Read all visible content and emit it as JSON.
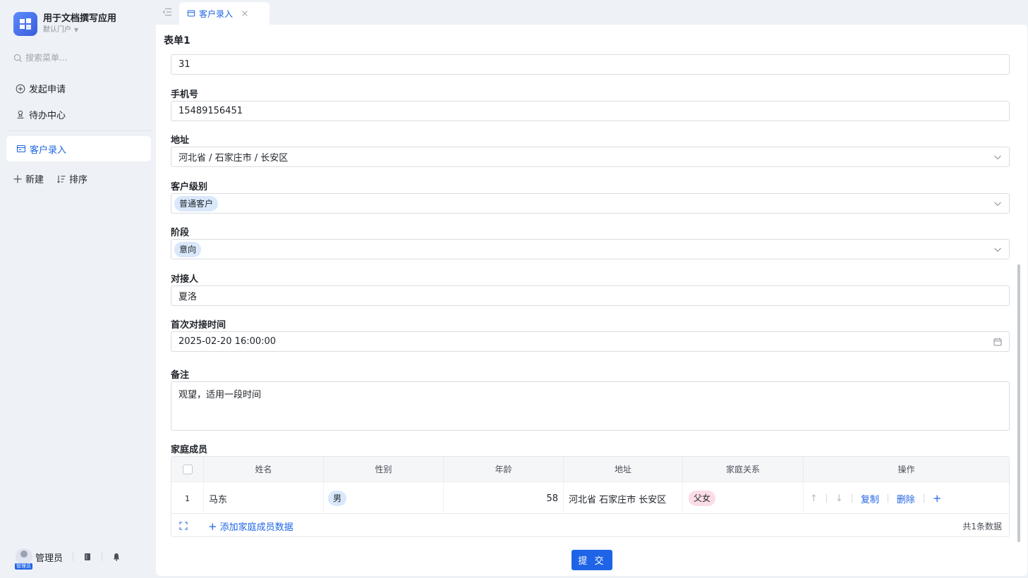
{
  "app": {
    "title": "用于文档撰写应用",
    "portal": "默认门户"
  },
  "sidebar": {
    "search_placeholder": "搜索菜单...",
    "items": [
      {
        "label": "发起申请",
        "icon": "plus-circle-icon"
      },
      {
        "label": "待办中心",
        "icon": "stamp-icon"
      }
    ],
    "active_item": {
      "label": "客户录入",
      "icon": "form-icon"
    },
    "new_label": "新建",
    "sort_label": "排序",
    "user": {
      "name": "管理员",
      "avatar_tag": "管理员"
    }
  },
  "tabs": [
    {
      "label": "客户录入"
    }
  ],
  "form": {
    "title": "表单1",
    "age_value": "31",
    "phone": {
      "label": "手机号",
      "value": "15489156451"
    },
    "address": {
      "label": "地址",
      "value": "河北省 / 石家庄市 / 长安区"
    },
    "level": {
      "label": "客户级别",
      "value": "普通客户"
    },
    "stage": {
      "label": "阶段",
      "value": "意向"
    },
    "contact": {
      "label": "对接人",
      "value": "夏洛"
    },
    "first_time": {
      "label": "首次对接时间",
      "value": "2025-02-20 16:00:00"
    },
    "remark": {
      "label": "备注",
      "value": "观望，适用一段时间"
    },
    "family": {
      "label": "家庭成员",
      "columns": [
        "姓名",
        "性别",
        "年龄",
        "地址",
        "家庭关系",
        "操作"
      ],
      "rows": [
        {
          "index": "1",
          "name": "马东",
          "gender": "男",
          "age": "58",
          "address": "河北省 石家庄市 长安区",
          "relation": "父女"
        }
      ],
      "ops": {
        "copy": "复制",
        "delete": "删除"
      },
      "add_label": "添加家庭成员数据",
      "count_text": "共1条数据"
    },
    "submit_label": "提 交"
  },
  "colors": {
    "accent": "#1f64e6",
    "chip_blue": "#d9e8fb",
    "chip_pink": "#fbdde6"
  }
}
